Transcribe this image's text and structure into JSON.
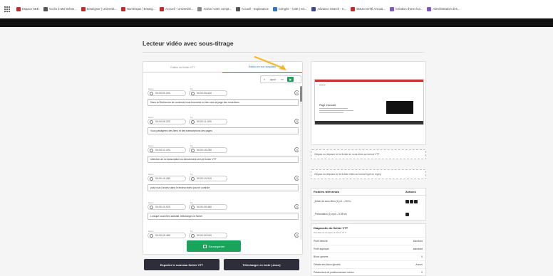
{
  "bookmarks": [
    {
      "label": "Espace SEE",
      "color": "#c62828"
    },
    {
      "label": "Accès à Moi-même...",
      "color": "#555555"
    },
    {
      "label": "Enseigner | Universit...",
      "color": "#c62828"
    },
    {
      "label": "Numérique | Enseig...",
      "color": "#c62828"
    },
    {
      "label": "Accueil - Université...",
      "color": "#c62828"
    },
    {
      "label": "Activer votre compt...",
      "color": "#888888"
    },
    {
      "label": "Accueil - Explorance",
      "color": "#555555"
    },
    {
      "label": "Congés – CSE | SC...",
      "color": "#2b77c9"
    },
    {
      "label": "Advance Search - C...",
      "color": "#3c4a8c"
    },
    {
      "label": "EDUCAUTÉ Annuai...",
      "color": "#c62828"
    },
    {
      "label": "Création d'une éva...",
      "color": "#7e57c2"
    },
    {
      "label": "Administration des...",
      "color": "#7e57c2"
    }
  ],
  "page": {
    "title": "Lecteur vidéo avec sous-titrage"
  },
  "tabs": {
    "tab1": "Édition du fichier VTT",
    "tab2": "Édition en vue simplifiée"
  },
  "toolbar": {
    "b1": "«",
    "b2": "ajout",
    "b3": "»»",
    "b4": "▣"
  },
  "cue_labels": {
    "start": "Début",
    "end": "Fin"
  },
  "cues": [
    {
      "n": "1",
      "start": "00:00:00.000",
      "end": "00:00:05.320",
      "text": "Dans la Recherche de contenus vous trouverez un lien vers la page des sous-titres"
    },
    {
      "n": "2",
      "start": "00:00:05.320",
      "end": "00:00:11.000",
      "text": "Vous partagerez des liens et des transcriptions des pages"
    },
    {
      "n": "3",
      "start": "00:00:11.000",
      "end": "00:00:15.280",
      "text": "sélection de la transcription ou directement vers le fichier VTT"
    },
    {
      "n": "4",
      "start": "00:00:15.280",
      "end": "00:00:19.920",
      "text": "puis vous l'ouvrez dans le lecteur vidéo pour le contrôle"
    },
    {
      "n": "5",
      "start": "00:00:19.920",
      "end": "00:00:25.480",
      "text": "Lorsque vous êtes satisfait, téléchargez le fichier"
    },
    {
      "n": "6",
      "start": "00:00:25.480",
      "end": "00:00:30.000",
      "text": ""
    }
  ],
  "buttons": {
    "save": "Sauvegarder",
    "export": "Exporter le nouveau fichier VTT",
    "download": "Télécharger en texte (.docx)"
  },
  "preview": {
    "page_title": "Page d'accueil"
  },
  "dropzones": {
    "vtt": "Cliquez ou déposez ici le fichier de sous-titres au format VTT",
    "video": "Cliquez ou déposez ici le fichier vidéo au format mp4 ou mpeg"
  },
  "files": {
    "header_name": "Fichiers téléversés",
    "header_actions": "Actions",
    "rows": [
      {
        "name": "_fichier-de-sous-titres (1).vtt – 2.8 Ko"
      },
      {
        "name": "_Présentation (1).mp4 – 8.28 Mo"
      }
    ]
  },
  "diagnostic": {
    "title": "Diagnostic du fichier VTT",
    "subtitle": "Résultats de l'analyse du fichier VTT",
    "rows": [
      {
        "k": "Profil détecté",
        "v": "standard"
      },
      {
        "k": "Profil appliqué",
        "v": "standard"
      },
      {
        "k": "Blocs ignorés",
        "v": "0"
      },
      {
        "k": "Détails des blocs ignorés",
        "v": "Aucun"
      },
      {
        "k": "Paramètres de positionnement retirés",
        "v": "0"
      }
    ]
  },
  "colors": {
    "accent": "#1aa35a",
    "tab_active": "#2b77c9",
    "dark_button": "#2e2e3a",
    "annotation_arrow": "#f5b82e"
  }
}
